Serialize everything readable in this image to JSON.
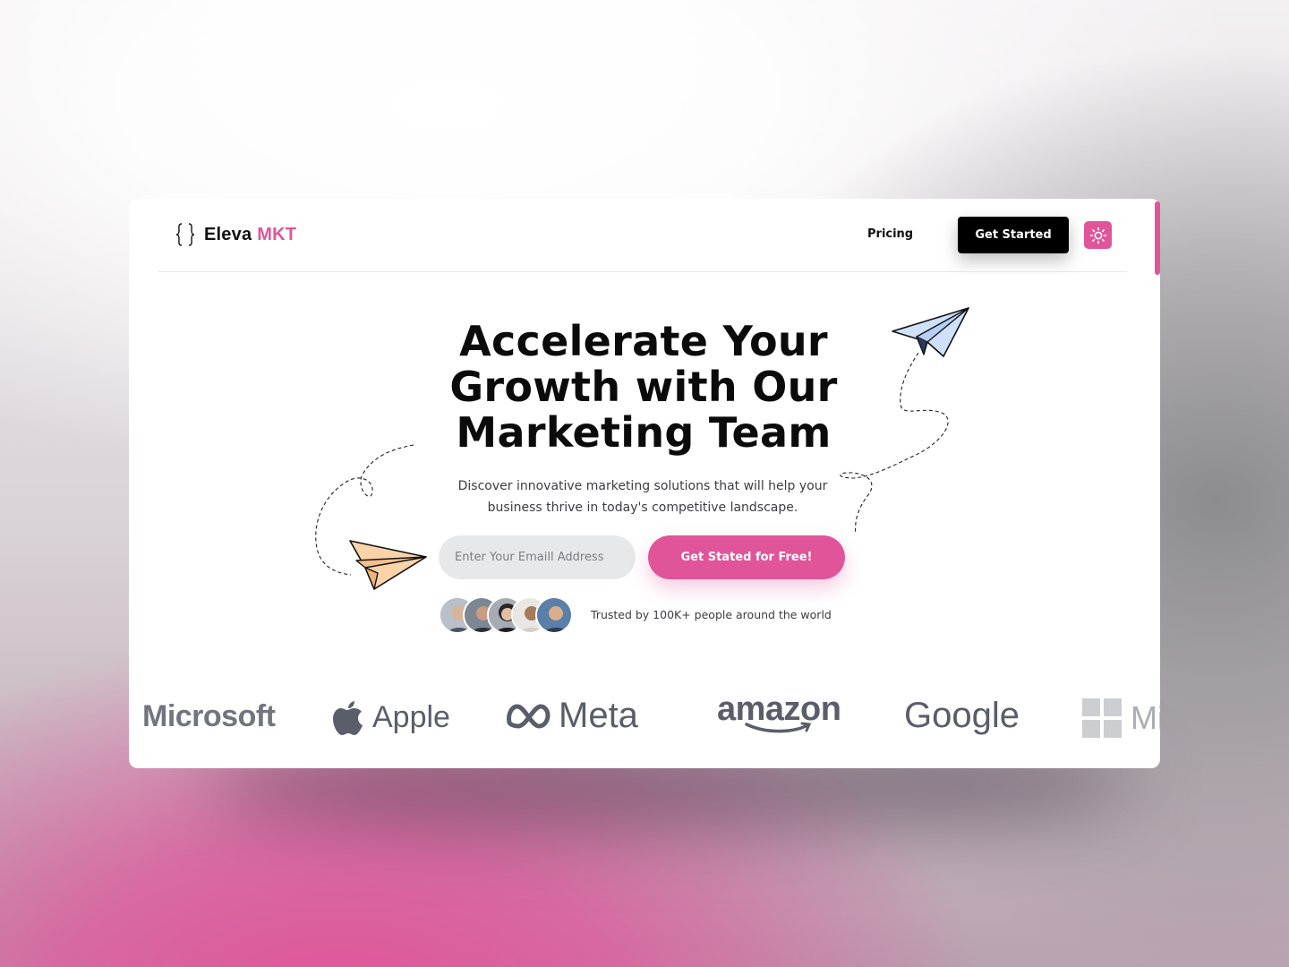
{
  "brand": {
    "name": "Eleva",
    "accent": "MKT",
    "icon": "curly-braces-icon"
  },
  "nav": {
    "pricing": "Pricing",
    "cta": "Get Started",
    "theme_icon": "sun-icon"
  },
  "hero": {
    "headline": "Accelerate Your Growth with Our Marketing Team",
    "subheading": "Discover innovative marketing solutions that will help your business thrive in today's competitive landscape.",
    "email_placeholder": "Enter Your Emaill Address",
    "cta": "Get Stated for Free!",
    "trusted": "Trusted by 100K+ people around the world"
  },
  "logos": [
    "Microsoft",
    "Apple",
    "Meta",
    "amazon",
    "Google",
    "Microsoft"
  ],
  "colors": {
    "accent": "#e0559a",
    "dark": "#000000",
    "plane_blue": "#cfe0fb",
    "plane_peach": "#fbd3a8",
    "logo_gray": "#5a5e6a"
  }
}
